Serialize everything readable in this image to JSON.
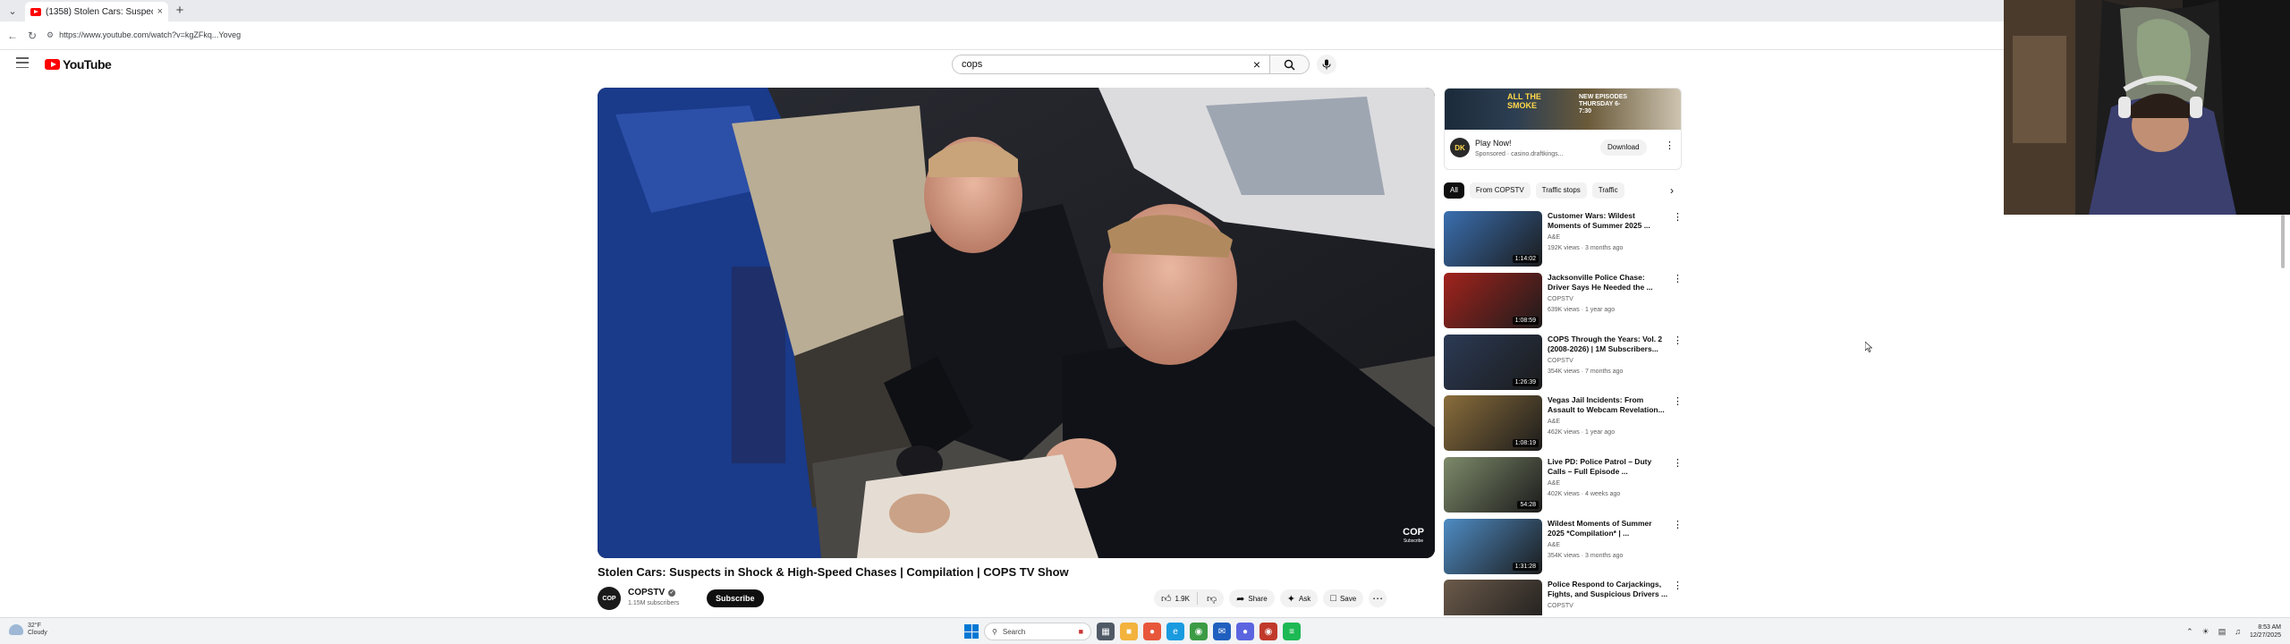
{
  "browser": {
    "tab_title": "(1358) Stolen Cars: Suspects i",
    "url": "https://www.youtube.com/watch?v=kgZFkq...Yoveg"
  },
  "youtube": {
    "logo_text": "YouTube",
    "search_query": "cops"
  },
  "video": {
    "title": "Stolen Cars: Suspects in Shock & High-Speed Chases | Compilation | COPS TV Show",
    "watermark": "COP",
    "watermark_sub": "Subscribe",
    "channel": {
      "name": "COPSTV",
      "subscribers": "1.15M subscribers",
      "avatar_text": "COP"
    },
    "subscribe_label": "Subscribe",
    "likes": "1.9K",
    "share_label": "Share",
    "ask_label": "Ask",
    "save_label": "Save"
  },
  "ad": {
    "banner_line1": "ALL THE",
    "banner_line2": "SMOKE",
    "banner_tag": "NEW EPISODES THURSDAY 6-7:30",
    "title": "Play Now!",
    "sponsored": "Sponsored · casino.draftkings...",
    "download_label": "Download",
    "logo_text": "DK"
  },
  "chips": [
    "All",
    "From COPSTV",
    "Traffic stops",
    "Traffic"
  ],
  "recommendations": [
    {
      "title": "Customer Wars: Wildest Moments of Summer 2025 ...",
      "channel": "A&E",
      "meta": "192K views · 3 months ago",
      "duration": "1:14:02",
      "color": "#3a6fb0"
    },
    {
      "title": "Jacksonville Police Chase: Driver Says He Needed the ...",
      "channel": "COPSTV",
      "meta": "639K views · 1 year ago",
      "duration": "1:08:59",
      "color": "#a2231d"
    },
    {
      "title": "COPS Through the Years: Vol. 2 (2008-2026) | 1M Subscribers...",
      "channel": "COPSTV",
      "meta": "354K views · 7 months ago",
      "duration": "1:26:39",
      "color": "#2b3a55"
    },
    {
      "title": "Vegas Jail Incidents: From Assault to Webcam Revelation...",
      "channel": "A&E",
      "meta": "462K views · 1 year ago",
      "duration": "1:08:19",
      "color": "#8a6d3b"
    },
    {
      "title": "Live PD: Police Patrol – Duty Calls – Full Episode ...",
      "channel": "A&E",
      "meta": "402K views · 4 weeks ago",
      "duration": "54:28",
      "color": "#7d8a6a"
    },
    {
      "title": "Wildest Moments of Summer 2025 *Compilation* | ...",
      "channel": "A&E",
      "meta": "354K views · 3 months ago",
      "duration": "1:31:28",
      "color": "#4e8cc4"
    },
    {
      "title": "Police Respond to Carjackings, Fights, and Suspicious Drivers ...",
      "channel": "COPSTV",
      "meta": "",
      "duration": "",
      "color": "#6b5a4a"
    }
  ],
  "taskbar": {
    "temp": "32°F",
    "condition": "Cloudy",
    "search_placeholder": "Search",
    "time": "8:53 AM",
    "date": "12/27/2025"
  }
}
